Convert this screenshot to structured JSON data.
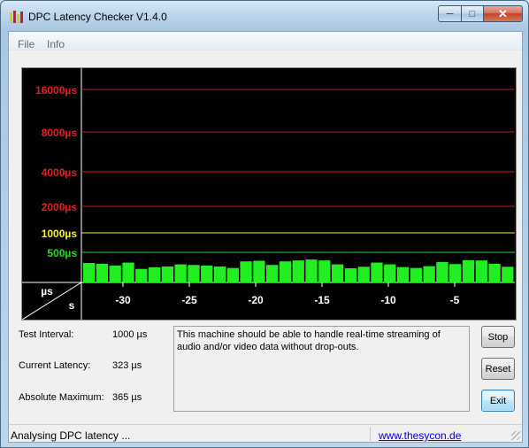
{
  "window": {
    "title": "DPC Latency Checker V1.4.0",
    "icon": "bar-chart-icon",
    "controls": {
      "minimize": "─",
      "maximize": "□",
      "close": "✕"
    }
  },
  "menu": {
    "items": [
      "File",
      "Info"
    ]
  },
  "graph": {
    "y_labels": [
      {
        "text": "16000µs",
        "color": "#e02020"
      },
      {
        "text": "8000µs",
        "color": "#e02020"
      },
      {
        "text": "4000µs",
        "color": "#e02020"
      },
      {
        "text": "2000µs",
        "color": "#e02020"
      },
      {
        "text": "1000µs",
        "color": "#f0f040"
      },
      {
        "text": "500µs",
        "color": "#22dd22"
      }
    ],
    "corner_top": "µs",
    "corner_bottom": "s",
    "x_labels": [
      "-30",
      "-25",
      "-20",
      "-15",
      "-10",
      "-5"
    ],
    "bar_color": "#22ee22",
    "bar_values_us": [
      323,
      310,
      280,
      330,
      225,
      250,
      265,
      300,
      290,
      280,
      265,
      240,
      350,
      360,
      290,
      350,
      365,
      380,
      365,
      300,
      235,
      260,
      330,
      300,
      255,
      240,
      270,
      340,
      305,
      370,
      365,
      310,
      260
    ]
  },
  "info": {
    "test_interval_label": "Test Interval:",
    "test_interval_value": "1000 µs",
    "current_latency_label": "Current Latency:",
    "current_latency_value": "323 µs",
    "absolute_max_label": "Absolute Maximum:",
    "absolute_max_value": "365 µs",
    "message": "This machine should be able to handle real-time streaming of audio and/or video data without drop-outs."
  },
  "buttons": {
    "stop": "Stop",
    "reset": "Reset",
    "exit": "Exit"
  },
  "status": {
    "text": "Analysing DPC latency ...",
    "link": "www.thesycon.de"
  }
}
